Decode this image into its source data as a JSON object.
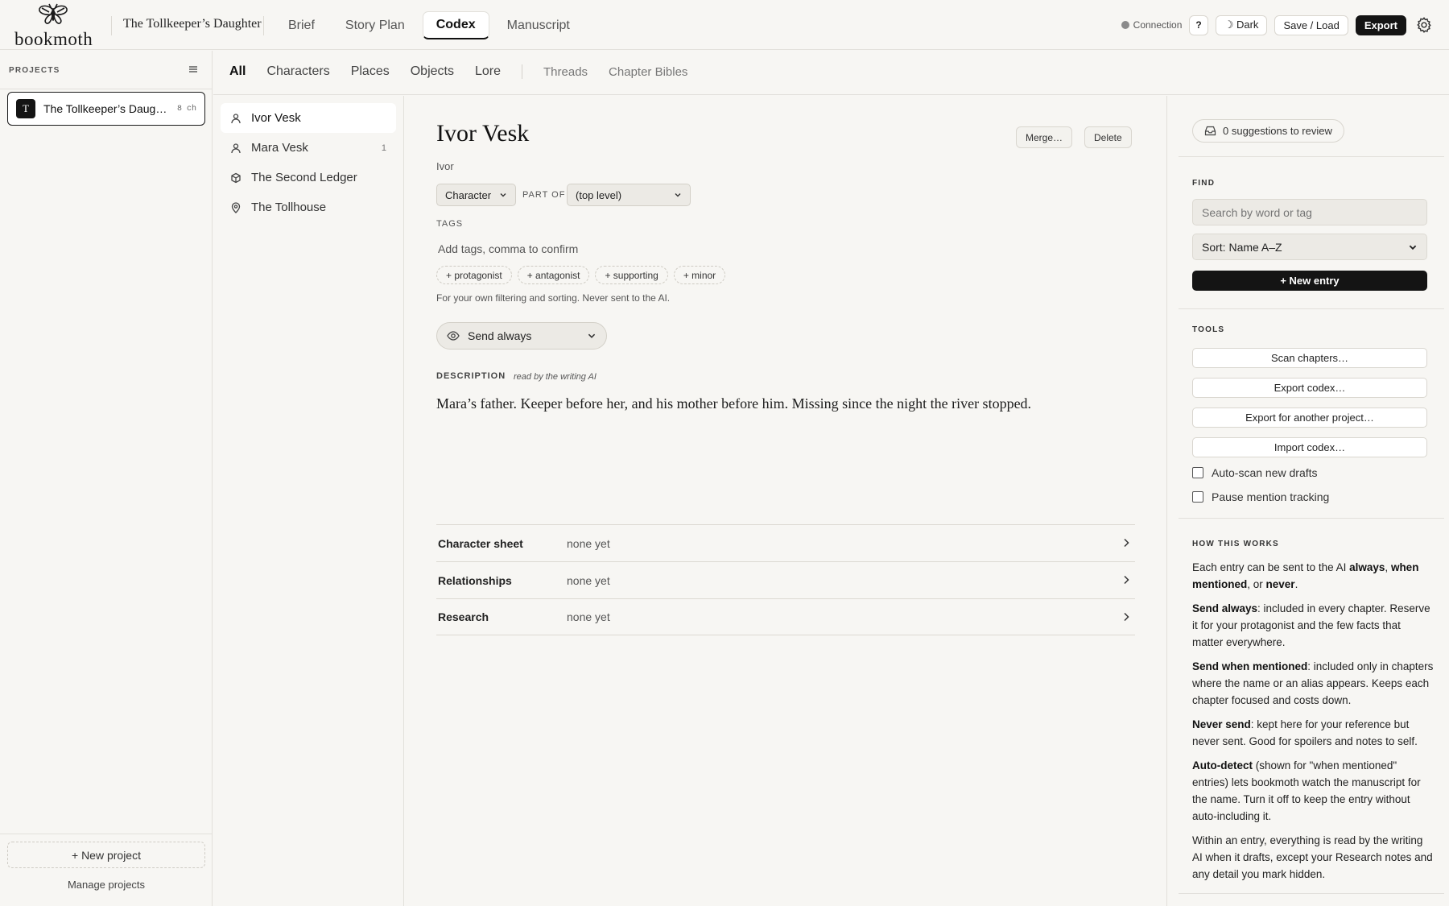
{
  "app": {
    "logo_text": "bookmoth",
    "project_title": "The Tollkeeper’s Daughter"
  },
  "nav": {
    "tabs": [
      {
        "label": "Brief"
      },
      {
        "label": "Story Plan"
      },
      {
        "label": "Codex",
        "active": true
      },
      {
        "label": "Manuscript"
      }
    ]
  },
  "topright": {
    "connection": "Connection",
    "help": "?",
    "dark": "☽ Dark",
    "save_load": "Save / Load",
    "export": "Export"
  },
  "sidebar": {
    "heading": "PROJECTS",
    "project": {
      "badge": "T",
      "name": "The Tollkeeper’s Daughter",
      "count": "8 ch"
    },
    "new_project": "+ New project",
    "manage": "Manage projects"
  },
  "subtabs": {
    "all": "All",
    "characters": "Characters",
    "places": "Places",
    "objects": "Objects",
    "lore": "Lore",
    "threads": "Threads",
    "chapter_bibles": "Chapter Bibles"
  },
  "entries": [
    {
      "name": "Ivor Vesk",
      "icon": "person-icon",
      "count": ""
    },
    {
      "name": "Mara Vesk",
      "icon": "person-icon",
      "count": "1"
    },
    {
      "name": "The Second Ledger",
      "icon": "cube-icon",
      "count": ""
    },
    {
      "name": "The Tollhouse",
      "icon": "map-pin-icon",
      "count": ""
    }
  ],
  "editor": {
    "name": "Ivor Vesk",
    "alias": "Ivor",
    "merge": "Merge…",
    "delete": "Delete",
    "type": "Character",
    "part_of_label": "PART OF",
    "part_of": "(top level)",
    "tags_label": "TAGS",
    "tags_placeholder": "Add tags, comma to confirm",
    "tag_suggestions": [
      "+ protagonist",
      "+ antagonist",
      "+ supporting",
      "+ minor"
    ],
    "tags_hint": "For your own filtering and sorting. Never sent to the AI.",
    "send_mode": "Send always",
    "description_label": "DESCRIPTION",
    "description_sub": "read by the writing AI",
    "description": "Mara’s father. Keeper before her, and his mother before him. Missing since the night the river stopped.",
    "sections": [
      {
        "title": "Character sheet",
        "value": "none yet"
      },
      {
        "title": "Relationships",
        "value": "none yet"
      },
      {
        "title": "Research",
        "value": "none yet"
      }
    ]
  },
  "right": {
    "suggestions": "0 suggestions to review",
    "find_label": "FIND",
    "search_placeholder": "Search by word or tag",
    "sort": "Sort: Name A–Z",
    "new_entry": "+ New entry",
    "tools_label": "TOOLS",
    "tools": [
      "Scan chapters…",
      "Export codex…",
      "Export for another project…",
      "Import codex…"
    ],
    "auto_scan": "Auto-scan new drafts",
    "pause_tracking": "Pause mention tracking",
    "how_label": "HOW THIS WORKS",
    "how": {
      "p1a": "Each entry can be sent to the AI ",
      "p1b": "always",
      "p1c": ", ",
      "p1d": "when mentioned",
      "p1e": ", or ",
      "p1f": "never",
      "p1g": ".",
      "p2a": "Send always",
      "p2b": ": included in every chapter. Reserve it for your protagonist and the few facts that matter everywhere.",
      "p3a": "Send when mentioned",
      "p3b": ": included only in chapters where the name or an alias appears. Keeps each chapter focused and costs down.",
      "p4a": "Never send",
      "p4b": ": kept here for your reference but never sent. Good for spoilers and notes to self.",
      "p5a": "Auto-detect",
      "p5b": " (shown for \"when mentioned\" entries) lets bookmoth watch the manuscript for the name. Turn it off to keep the entry without auto-including it.",
      "p6": "Within an entry, everything is read by the writing AI when it drafts, except your Research notes and any detail you mark hidden."
    }
  }
}
